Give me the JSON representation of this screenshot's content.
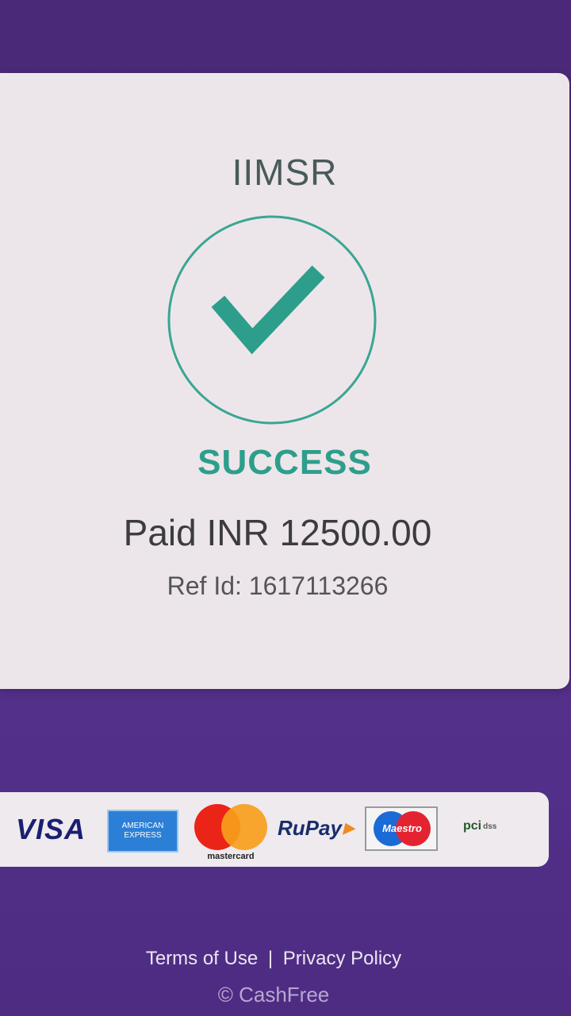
{
  "merchant": {
    "name": "IIMSR"
  },
  "status": {
    "label": "SUCCESS",
    "amount_text": "Paid INR 12500.00",
    "ref_text": "Ref Id: 1617113266",
    "accent_color": "#2e9e8c"
  },
  "payment_methods": {
    "visa": "VISA",
    "amex_line1": "AMERICAN",
    "amex_line2": "EXPRESS",
    "mastercard": "mastercard",
    "rupay": "RuPay",
    "maestro": "Maestro",
    "pci": "pci",
    "pci_suffix": "dss"
  },
  "footer": {
    "terms": "Terms of Use",
    "separator": "|",
    "privacy": "Privacy Policy",
    "copyright": "© CashFree"
  },
  "colors": {
    "background": "#4b2b7c",
    "card": "#ece6ea"
  },
  "icons": {
    "status_icon": "checkmark-circle-icon"
  }
}
